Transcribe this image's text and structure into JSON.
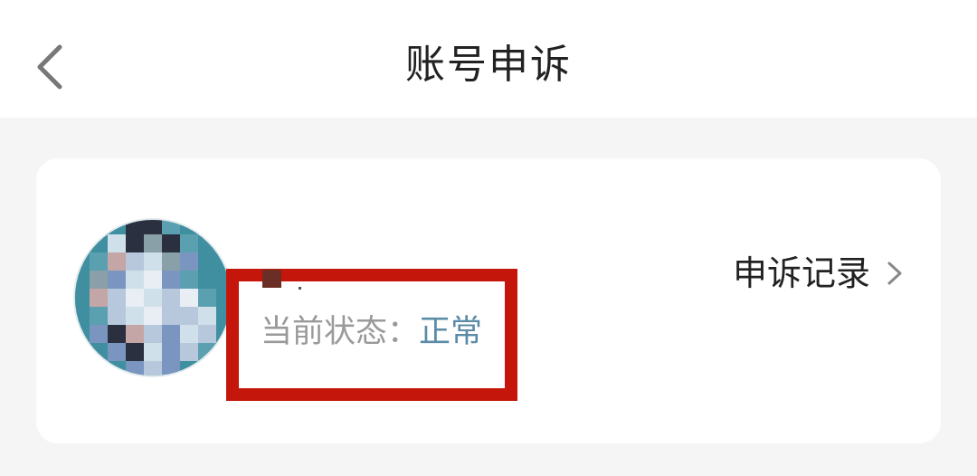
{
  "header": {
    "title": "账号申诉",
    "back_icon": "chevron-left-icon"
  },
  "account": {
    "avatar_icon": "avatar-mosaic",
    "status_label": "当前状态：",
    "status_value": "正常"
  },
  "appeal_records": {
    "label": "申诉记录",
    "icon": "chevron-right-icon"
  },
  "colors": {
    "status_value": "#5b8ba6",
    "annotation_box": "#c4160a",
    "title_text": "#222222",
    "secondary_text": "#9a9a9a",
    "background": "#f5f5f5"
  }
}
